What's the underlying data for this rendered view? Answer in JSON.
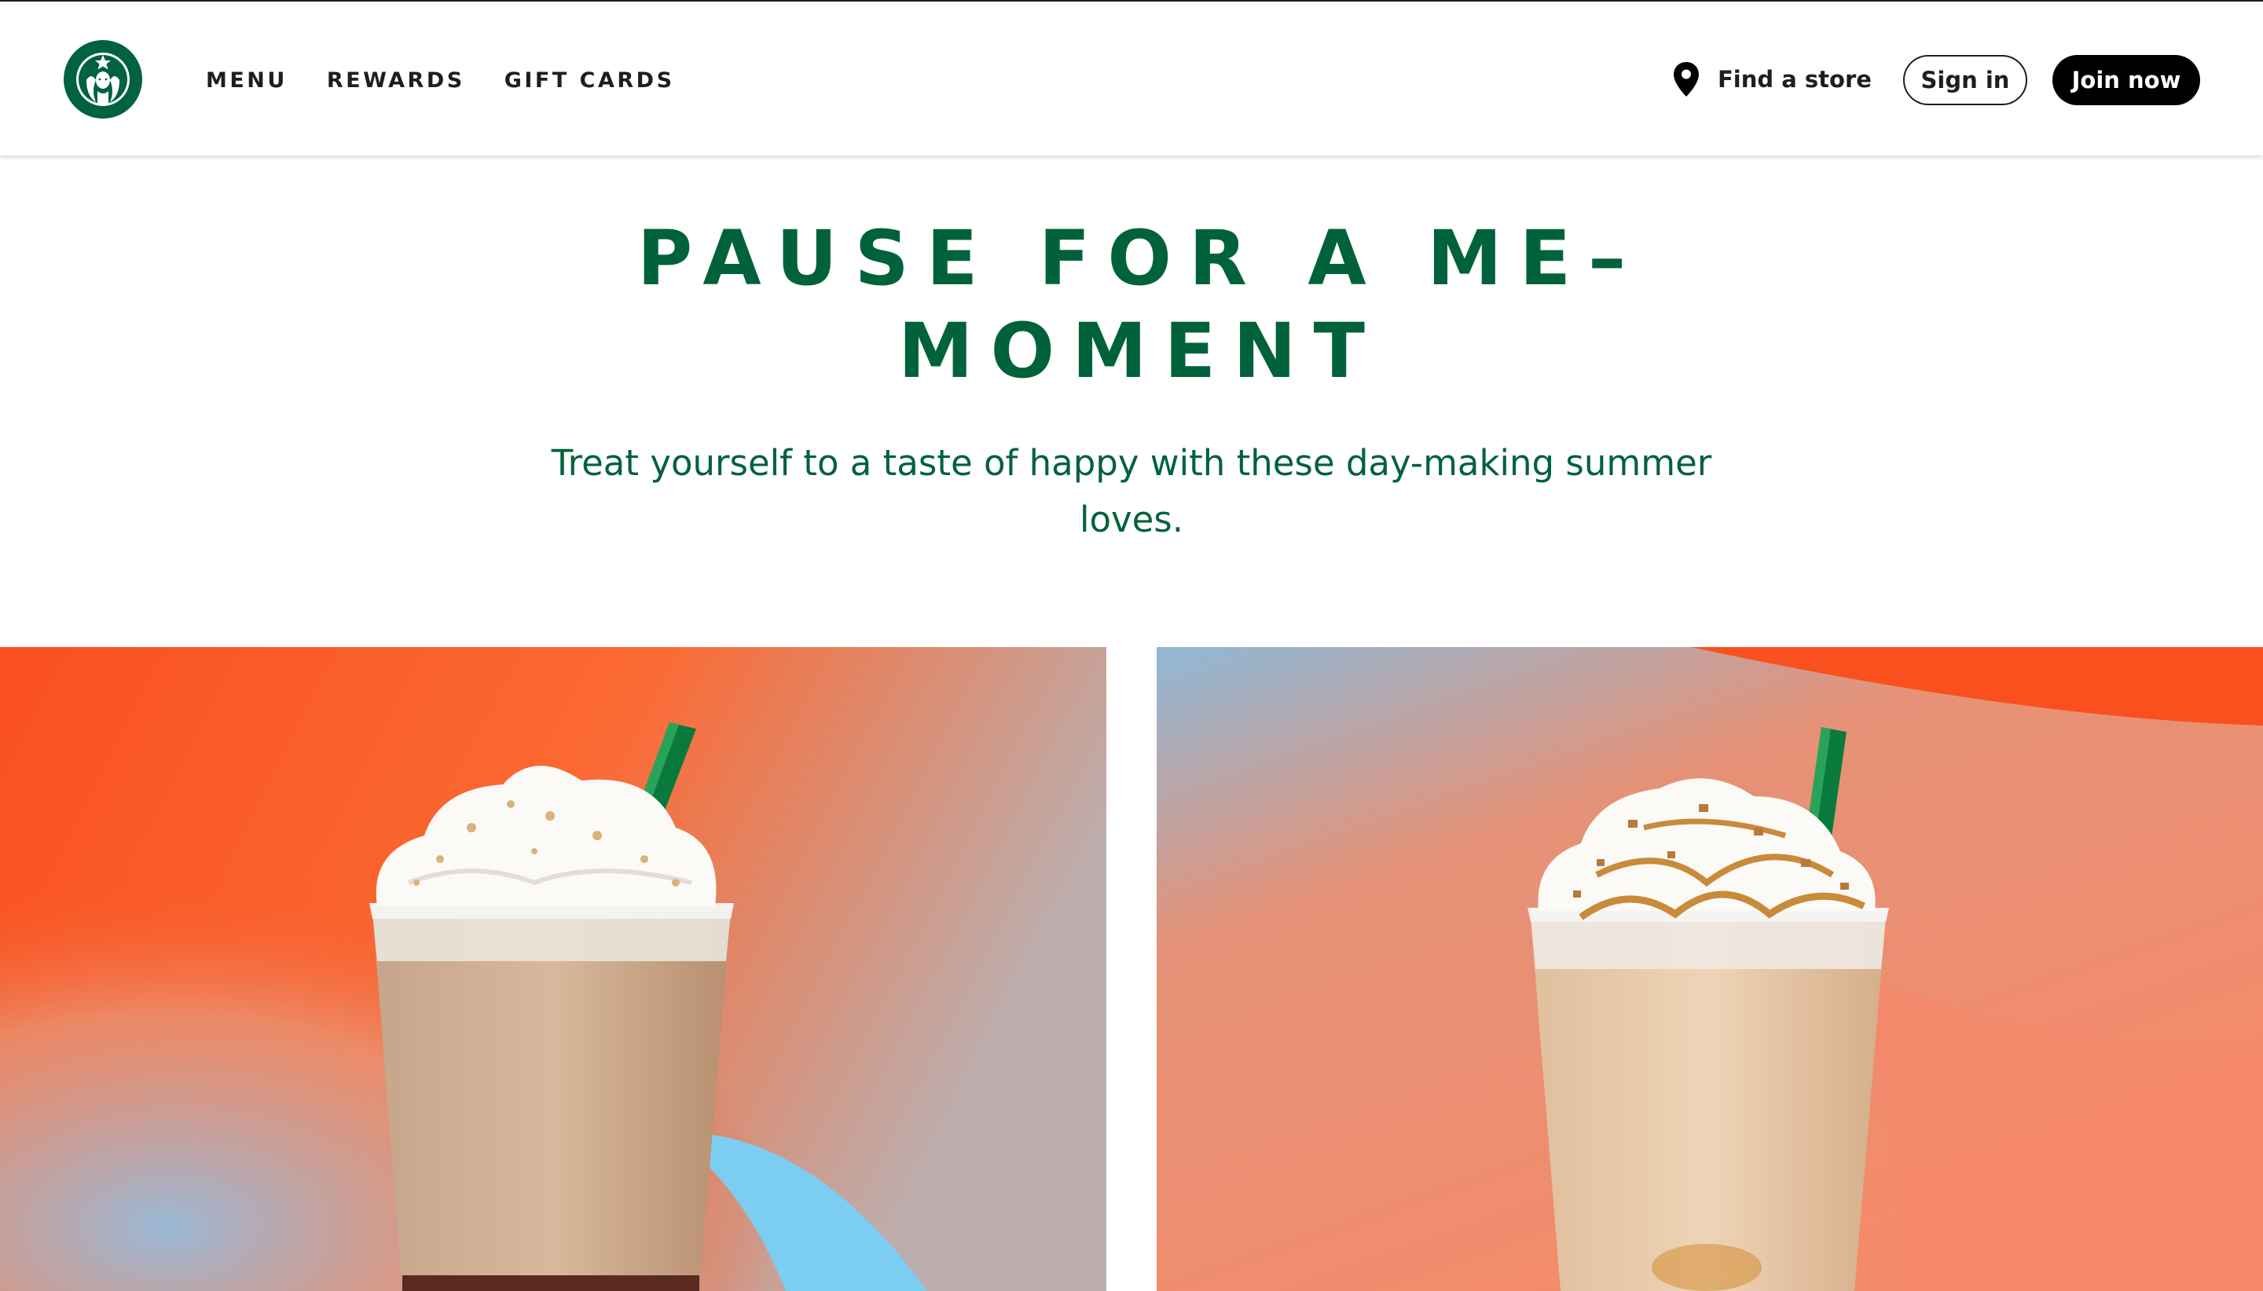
{
  "header": {
    "logo_icon": "starbucks-siren-logo",
    "nav": [
      {
        "label": "MENU"
      },
      {
        "label": "REWARDS"
      },
      {
        "label": "GIFT CARDS"
      }
    ],
    "find_store": {
      "icon": "location-pin-icon",
      "label": "Find a store"
    },
    "sign_in_label": "Sign in",
    "join_now_label": "Join now"
  },
  "hero": {
    "title": "PAUSE FOR A ME-MOMENT",
    "title_lines": [
      "PAUSE FOR A ME–",
      "MOMENT"
    ],
    "subtitle_lines": [
      "Treat yourself to a taste of happy with these day-making summer",
      "loves."
    ]
  },
  "colors": {
    "brand_green": "#00623b",
    "logo_green": "#006241",
    "accent_orange": "#f9501e",
    "accent_blue": "#7ccdf2",
    "black": "#000000"
  },
  "products": [
    {
      "image": "frappuccino-with-graham-crumble-on-orange-blue-background"
    },
    {
      "image": "caramel-frappuccino-with-toffee-on-orange-blue-background"
    }
  ]
}
